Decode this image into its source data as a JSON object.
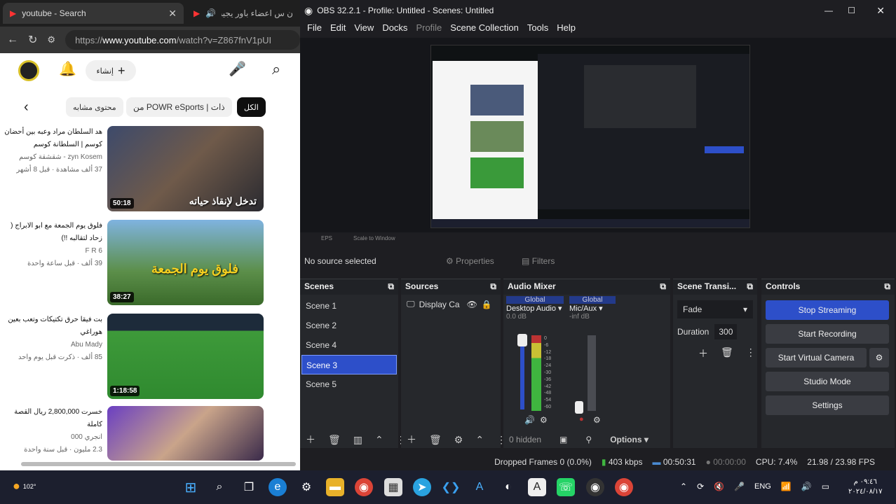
{
  "browser": {
    "tabs": [
      {
        "label": "youtube - Search",
        "close": "✕"
      },
      {
        "label": "ن س اعضاء باور يجيب",
        "close": ""
      }
    ],
    "url_prefix": "https://",
    "url_host": "www.youtube.com",
    "url_path": "/watch?v=Z867fnV1pUI",
    "create_label": "إنشاء",
    "chips": [
      "الكل",
      "من POWR eSports | ذات",
      "محتوى مشابه"
    ],
    "videos": [
      {
        "title": "هد السلطان مراد وعبه بين أحضان كوسم | السلطانة كوسم",
        "channel": "zyn Kosem - شقشقة كوسم",
        "stats": "37 ألف مشاهدة · قبل 8 أشهر",
        "duration": "50:18",
        "thumb_text": "تدخل لإنقاذ حياته"
      },
      {
        "title": "فلوق يوم الجمعة مع ابو الابراج ( زحاد لتقالبه !!)",
        "channel": "F R 6",
        "stats": "39 ألف · قبل ساعة واحدة",
        "duration": "38:27",
        "thumb_text": "فلوق يوم الجمعة"
      },
      {
        "title": "بت فيقا حرق تكتيكات وتعب بعين هوراغي",
        "channel": "Abu Mady",
        "stats": "85 ألف · ذكرت قبل يوم واحد",
        "duration": "1:18:58",
        "thumb_text": ""
      },
      {
        "title": "خسرت 2,800,000 ريال القصة كاملة",
        "channel": "انجري 000",
        "stats": "2.3 مليون · قبل سنة واحدة",
        "duration": "",
        "thumb_text": ""
      }
    ]
  },
  "obs": {
    "title": "OBS 32.2.1 - Profile: Untitled - Scenes: Untitled",
    "menu": [
      "File",
      "Edit",
      "View",
      "Docks",
      "Profile",
      "Scene Collection",
      "Tools",
      "Help"
    ],
    "no_source": "No source selected",
    "properties": "Properties",
    "filters": "Filters",
    "scene_info": [
      "EPS",
      "Scale to Window"
    ],
    "docks": {
      "scenes": {
        "title": "Scenes",
        "items": [
          "Scene 1",
          "Scene 2",
          "Scene 4",
          "Scene 3",
          "Scene 5"
        ],
        "selected": 3
      },
      "sources": {
        "title": "Sources",
        "items": [
          "Display Ca"
        ]
      },
      "mixer": {
        "title": "Audio Mixer",
        "channels": [
          {
            "scope": "Global",
            "name": "Desktop Audio",
            "level": "0.0 dB"
          },
          {
            "scope": "Global",
            "name": "Mic/Aux",
            "level": "-inf dB"
          }
        ],
        "hidden": "0 hidden",
        "options": "Options",
        "ticks": [
          "0",
          "-6",
          "-12",
          "-18",
          "-24",
          "-30",
          "-36",
          "-42",
          "-48",
          "-54",
          "-60"
        ]
      },
      "transitions": {
        "title": "Scene Transi...",
        "type": "Fade",
        "duration_label": "Duration",
        "duration_value": "300"
      },
      "controls": {
        "title": "Controls",
        "buttons": [
          "Stop Streaming",
          "Start Recording",
          "Start Virtual Camera",
          "Studio Mode",
          "Settings"
        ]
      }
    },
    "status": {
      "dropped": "Dropped Frames 0 (0.0%)",
      "bitrate": "403 kbps",
      "stream_time": "00:50:31",
      "rec_time": "00:00:00",
      "cpu": "CPU: 7.4%",
      "fps": "21.98 / 23.98 FPS"
    }
  },
  "taskbar": {
    "weather": "102°",
    "lang": "ENG",
    "time": "٠٩:٤٦ م",
    "date": "٢٠٢٤/٠٨/١٧"
  },
  "colors": {
    "accent": "#2d4fc9",
    "meter_green": "#3fb53f",
    "meter_yellow": "#c8c034",
    "meter_red": "#b33"
  }
}
